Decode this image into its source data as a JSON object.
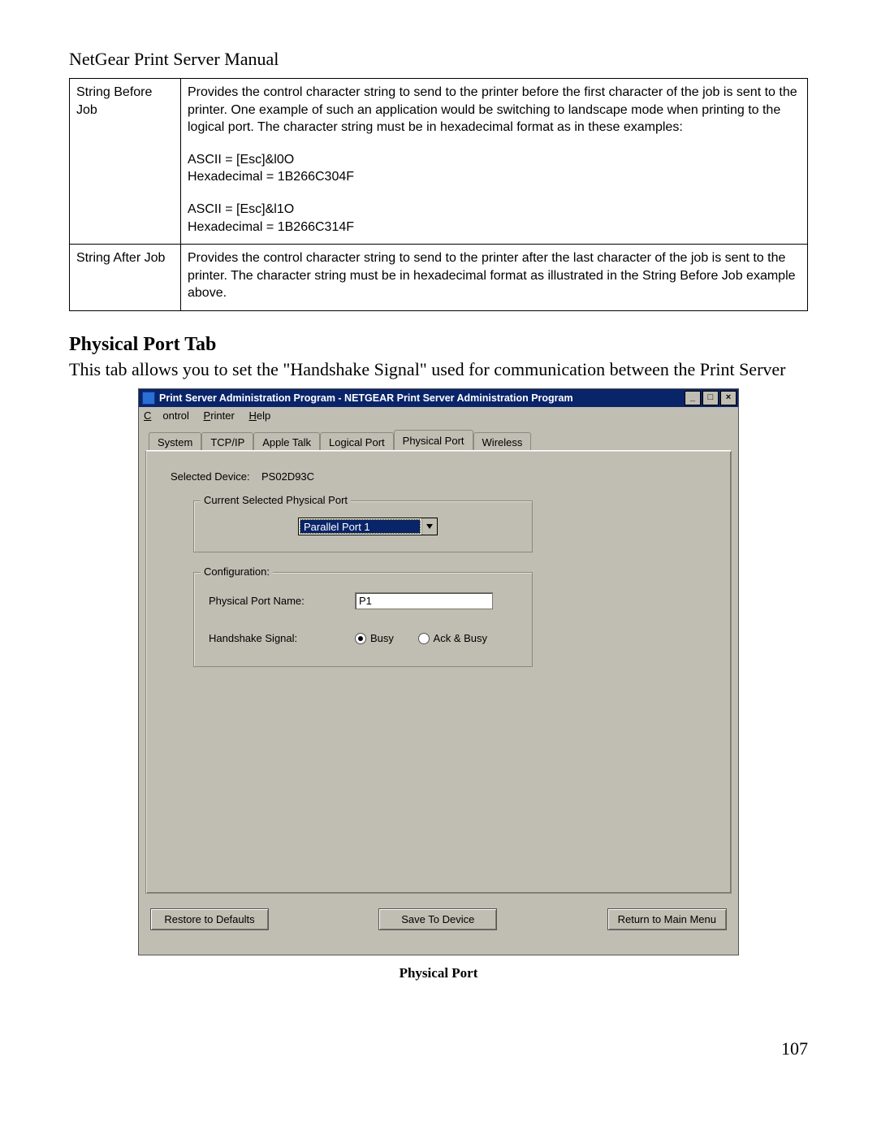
{
  "doc": {
    "header": "NetGear Print Server Manual",
    "page_number": "107"
  },
  "table": {
    "rows": [
      {
        "term": "String Before Job",
        "desc": "Provides the control character string to send to the printer before the first character of the job is sent to the printer. One example of such an application would be switching to landscape mode when printing to the logical port. The character string must be in hexadecimal format as in these examples:",
        "code1": "ASCII = [Esc]&l0O\n  Hexadecimal = 1B266C304F",
        "code2": "ASCII = [Esc]&l1O\n  Hexadecimal = 1B266C314F"
      },
      {
        "term": "String After Job",
        "desc": "Provides the control character string to send to the printer after the last character of the job is sent to the printer. The character string must be in hexadecimal format as illustrated in the String Before Job example above."
      }
    ]
  },
  "section": {
    "heading": "Physical Port Tab",
    "intro": "This tab allows you to set the \"Handshake Signal\" used for communication between the Print Server"
  },
  "window": {
    "title": "Print Server Administration Program - NETGEAR Print Server Administration Program",
    "menu": {
      "control": "Control",
      "printer": "Printer",
      "help": "Help"
    },
    "tabs": {
      "system": "System",
      "tcpip": "TCP/IP",
      "appletalk": "Apple Talk",
      "logical": "Logical Port",
      "physical": "Physical Port",
      "wireless": "Wireless"
    },
    "selected_device_label": "Selected Device:",
    "selected_device_value": "PS02D93C",
    "group_port": {
      "legend": "Current Selected Physical Port",
      "dropdown_value": "Parallel Port 1"
    },
    "group_cfg": {
      "legend": "Configuration:",
      "port_name_label": "Physical Port Name:",
      "port_name_value": "P1",
      "handshake_label": "Handshake Signal:",
      "radio_busy": "Busy",
      "radio_ackbusy": "Ack & Busy"
    },
    "buttons": {
      "restore": "Restore to Defaults",
      "save": "Save To Device",
      "return": "Return to Main Menu"
    }
  },
  "caption": "Physical Port"
}
